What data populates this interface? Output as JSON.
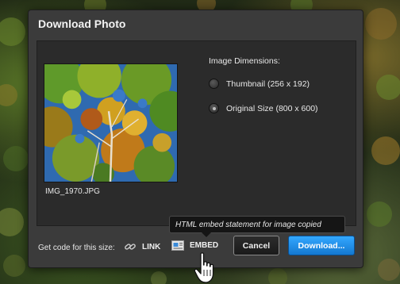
{
  "dialog": {
    "title": "Download Photo",
    "filename": "IMG_1970.JPG",
    "dimensions_label": "Image Dimensions:",
    "options": [
      {
        "label": "Thumbnail (256 x 192)",
        "selected": false
      },
      {
        "label": "Original Size (800 x 600)",
        "selected": true
      }
    ]
  },
  "footer": {
    "get_code_label": "Get code for this size:",
    "link_label": "LINK",
    "embed_label": "EMBED",
    "tooltip": "HTML embed statement for image copied",
    "cancel_label": "Cancel",
    "download_label": "Download..."
  },
  "icons": {
    "link": "chain-link-icon",
    "embed": "embed-code-icon",
    "cursor": "hand-pointer-icon"
  },
  "colors": {
    "dialog_bg": "#3b3b3b",
    "panel_bg": "#2b2b2b",
    "download_button": "#1e8ee8",
    "text": "#e8e8e8"
  }
}
